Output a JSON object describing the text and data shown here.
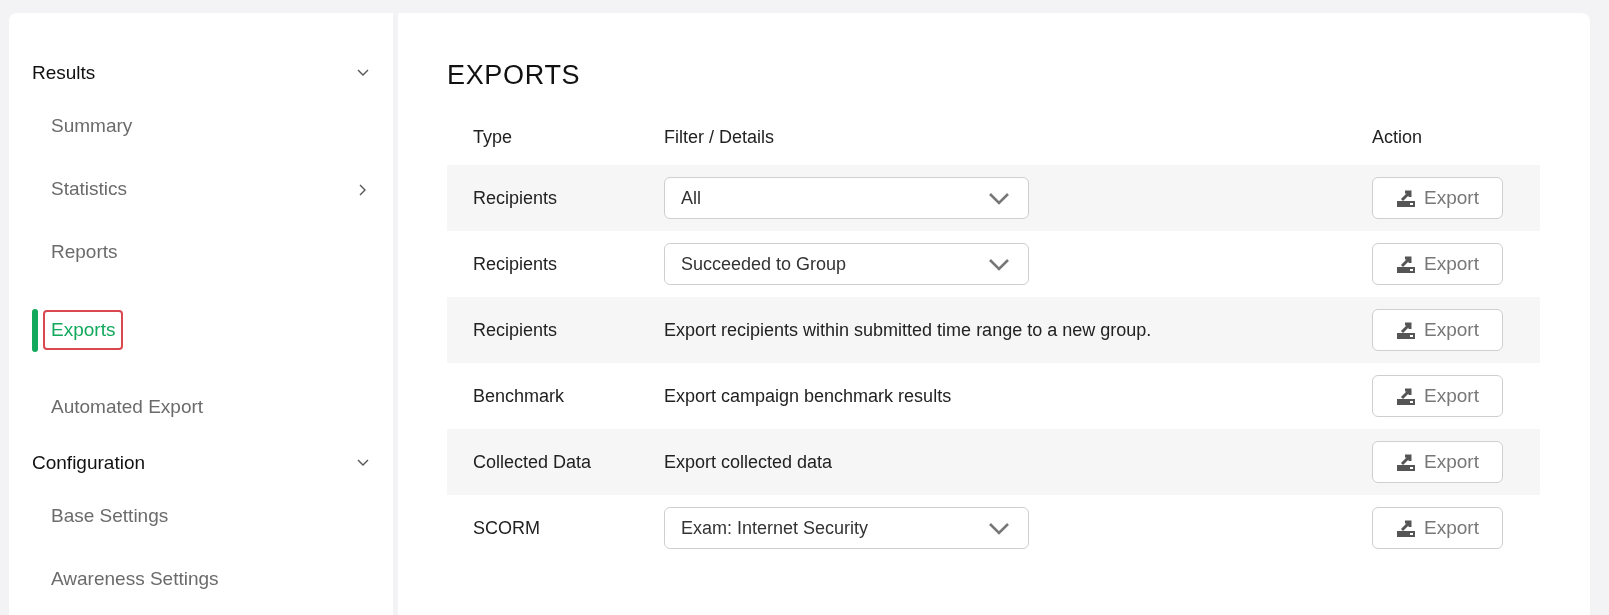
{
  "sidebar": {
    "sections": [
      {
        "label": "Results",
        "expanded": true,
        "items": [
          {
            "label": "Summary",
            "selected": false,
            "has_submenu": false
          },
          {
            "label": "Statistics",
            "selected": false,
            "has_submenu": true
          },
          {
            "label": "Reports",
            "selected": false,
            "has_submenu": false
          },
          {
            "label": "Exports",
            "selected": true,
            "has_submenu": false
          },
          {
            "label": "Automated Export",
            "selected": false,
            "has_submenu": false
          }
        ]
      },
      {
        "label": "Configuration",
        "expanded": true,
        "items": [
          {
            "label": "Base Settings",
            "selected": false,
            "has_submenu": false
          },
          {
            "label": "Awareness Settings",
            "selected": false,
            "has_submenu": false
          }
        ]
      }
    ]
  },
  "main": {
    "title": "EXPORTS",
    "table": {
      "columns": [
        "Type",
        "Filter / Details",
        "Action"
      ],
      "rows": [
        {
          "type": "Recipients",
          "kind": "select",
          "details": "All",
          "action": "Export"
        },
        {
          "type": "Recipients",
          "kind": "select",
          "details": "Succeeded to Group",
          "action": "Export"
        },
        {
          "type": "Recipients",
          "kind": "text",
          "details": "Export recipients within submitted time range to a new group.",
          "action": "Export"
        },
        {
          "type": "Benchmark",
          "kind": "text",
          "details": "Export campaign benchmark results",
          "action": "Export"
        },
        {
          "type": "Collected Data",
          "kind": "text",
          "details": "Export collected data",
          "action": "Export"
        },
        {
          "type": "SCORM",
          "kind": "select",
          "details": "Exam: Internet Security",
          "action": "Export"
        }
      ]
    }
  }
}
